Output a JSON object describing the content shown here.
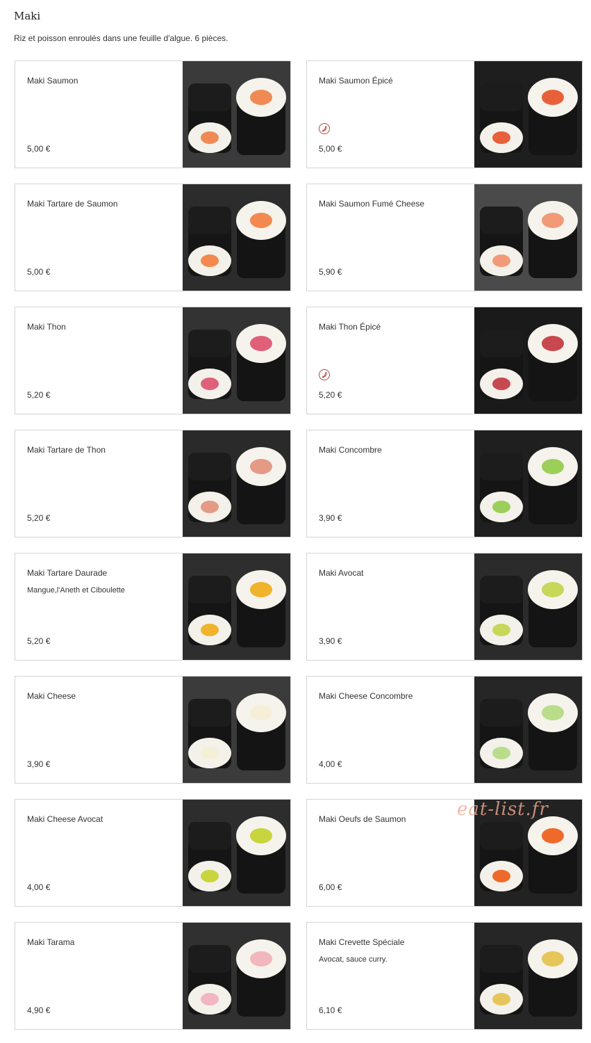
{
  "section": {
    "title": "Maki",
    "description": "Riz et poisson enroulés dans une feuille d'algue. 6 pièces."
  },
  "items": [
    {
      "name": "Maki Saumon",
      "desc": "",
      "price": "5,00 €",
      "spicy": false,
      "filling": "#f08a55",
      "bg": "#3a3a3a"
    },
    {
      "name": "Maki Saumon Épicé",
      "desc": "",
      "price": "5,00 €",
      "spicy": true,
      "filling": "#e8603a",
      "bg": "#1e1e1e"
    },
    {
      "name": "Maki Tartare de Saumon",
      "desc": "",
      "price": "5,00 €",
      "spicy": false,
      "filling": "#f3894e",
      "bg": "#2c2c2c"
    },
    {
      "name": "Maki Saumon Fumé Cheese",
      "desc": "",
      "price": "5,90 €",
      "spicy": false,
      "filling": "#f29a78",
      "bg": "#4a4a4a"
    },
    {
      "name": "Maki Thon",
      "desc": "",
      "price": "5,20 €",
      "spicy": false,
      "filling": "#e0607a",
      "bg": "#333333"
    },
    {
      "name": "Maki Thon Épicé",
      "desc": "",
      "price": "5,20 €",
      "spicy": true,
      "filling": "#c8484f",
      "bg": "#1a1a1a"
    },
    {
      "name": "Maki Tartare de Thon",
      "desc": "",
      "price": "5,20 €",
      "spicy": false,
      "filling": "#e59a86",
      "bg": "#2a2a2a"
    },
    {
      "name": "Maki Concombre",
      "desc": "",
      "price": "3,90 €",
      "spicy": false,
      "filling": "#9ccf5a",
      "bg": "#1f1f1f"
    },
    {
      "name": "Maki Tartare Daurade",
      "desc": "Mangue,l'Aneth et Ciboulette",
      "price": "5,20 €",
      "spicy": false,
      "filling": "#f0b32c",
      "bg": "#2e2e2e"
    },
    {
      "name": "Maki Avocat",
      "desc": "",
      "price": "3,90 €",
      "spicy": false,
      "filling": "#c8d75a",
      "bg": "#2b2b2b"
    },
    {
      "name": "Maki Cheese",
      "desc": "",
      "price": "3,90 €",
      "spicy": false,
      "filling": "#f6efd8",
      "bg": "#3b3b3b"
    },
    {
      "name": "Maki Cheese Concombre",
      "desc": "",
      "price": "4,00 €",
      "spicy": false,
      "filling": "#b9dd8a",
      "bg": "#262626"
    },
    {
      "name": "Maki Cheese Avocat",
      "desc": "",
      "price": "4,00 €",
      "spicy": false,
      "filling": "#c9d53c",
      "bg": "#2d2d2d"
    },
    {
      "name": "Maki Oeufs de Saumon",
      "desc": "",
      "price": "6,00 €",
      "spicy": false,
      "filling": "#ef6a2a",
      "bg": "#222222"
    },
    {
      "name": "Maki Tarama",
      "desc": "",
      "price": "4,90 €",
      "spicy": false,
      "filling": "#f2b6c0",
      "bg": "#303030"
    },
    {
      "name": "Maki Crevette Spéciale",
      "desc": "Avocat, sauce curry.",
      "price": "6,10 €",
      "spicy": false,
      "filling": "#e6c65a",
      "bg": "#262626"
    }
  ],
  "watermark": "eat-list.fr",
  "icons": {
    "spicy": "chili-icon"
  }
}
